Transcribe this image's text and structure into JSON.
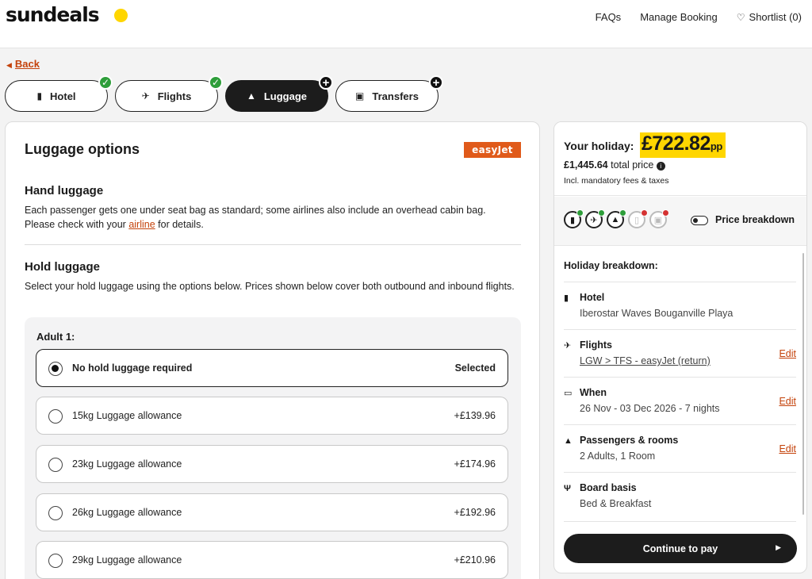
{
  "header": {
    "logo": "sundeals",
    "nav": [
      "FAQs",
      "Manage Booking",
      "Shortlist (0)"
    ]
  },
  "back_label": "Back",
  "steps": [
    {
      "label": "Hotel",
      "icon": "building-icon",
      "status": "done"
    },
    {
      "label": "Flights",
      "icon": "plane-icon",
      "status": "done"
    },
    {
      "label": "Luggage",
      "icon": "bag-icon",
      "status": "active"
    },
    {
      "label": "Transfers",
      "icon": "bus-icon",
      "status": "add"
    }
  ],
  "main": {
    "title": "Luggage options",
    "airline_logo": "easyJet",
    "hand_title": "Hand luggage",
    "hand_text_1": "Each passenger gets one under seat bag as standard; some airlines also include an overhead cabin bag.",
    "hand_text_2a": "Please check with your ",
    "hand_text_link": "airline",
    "hand_text_2b": " for details.",
    "hold_title": "Hold luggage",
    "hold_text": "Select your hold luggage using the options below. Prices shown below cover both outbound and inbound flights.",
    "passenger": "Adult 1:",
    "options": [
      {
        "label": "No hold luggage required",
        "price": "Selected",
        "selected": true
      },
      {
        "label": "15kg Luggage allowance",
        "price": "+£139.96",
        "selected": false
      },
      {
        "label": "23kg Luggage allowance",
        "price": "+£174.96",
        "selected": false
      },
      {
        "label": "26kg Luggage allowance",
        "price": "+£192.96",
        "selected": false
      },
      {
        "label": "29kg Luggage allowance",
        "price": "+£210.96",
        "selected": false
      }
    ]
  },
  "summary": {
    "your_holiday": "Your holiday:",
    "price_pp": "£722.82",
    "pp": "pp",
    "total_amount": "£1,445.64",
    "total_label": "total price",
    "incl": "Incl. mandatory fees & taxes",
    "price_breakdown": "Price breakdown",
    "breakdown_title": "Holiday breakdown:",
    "rows": [
      {
        "title": "Hotel",
        "detail": "Iberostar Waves Bouganville Playa",
        "edit": ""
      },
      {
        "title": "Flights",
        "detail": "LGW > TFS - easyJet (return)",
        "edit": "Edit"
      },
      {
        "title": "When",
        "detail": "26 Nov - 03 Dec 2026 - 7 nights",
        "edit": "Edit"
      },
      {
        "title": "Passengers & rooms",
        "detail": "2 Adults, 1 Room",
        "edit": "Edit"
      },
      {
        "title": "Board basis",
        "detail": "Bed & Breakfast",
        "edit": ""
      }
    ],
    "continue": "Continue to pay"
  },
  "colors": {
    "brand_yellow": "#ffd600",
    "link_orange": "#c4420a",
    "success_green": "#2e9e3a",
    "error_red": "#d43232",
    "easyjet_orange": "#e05a1a"
  }
}
